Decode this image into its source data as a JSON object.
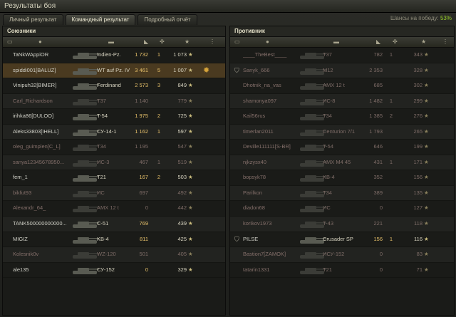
{
  "window": {
    "title": "Результаты боя"
  },
  "tabs": [
    {
      "label": "Личный результат",
      "active": false
    },
    {
      "label": "Командный результат",
      "active": true
    },
    {
      "label": "Подробный отчёт",
      "active": false
    }
  ],
  "chance": {
    "label": "Шансы на победу:",
    "value": "53%"
  },
  "allies": {
    "title": "Союзники",
    "rows": [
      {
        "player": "TaNkWAppiOR",
        "vehicle": "Indien-Pz.",
        "dmg": "1 732",
        "frags": "1",
        "xp": "1 073",
        "dead": false
      },
      {
        "player": "spiddi001[BALUZ]",
        "vehicle": "WT auf Pz. IV",
        "dmg": "3 461",
        "frags": "5",
        "xp": "1 007",
        "dead": false,
        "highlight": true,
        "medal": true
      },
      {
        "player": "Vinipuh32[BIMER]",
        "vehicle": "Ferdinand",
        "dmg": "2 573",
        "frags": "3",
        "xp": "849",
        "dead": false
      },
      {
        "player": "Carl_Richardson",
        "vehicle": "T37",
        "dmg": "1 140",
        "frags": "",
        "xp": "779",
        "dead": true
      },
      {
        "player": "irihka86[DULOO]",
        "vehicle": "T-54",
        "dmg": "1 975",
        "frags": "2",
        "xp": "725",
        "dead": false
      },
      {
        "player": "Aleks33803[IHELL]",
        "vehicle": "СУ-14-1",
        "dmg": "1 162",
        "frags": "1",
        "xp": "597",
        "dead": false
      },
      {
        "player": "oleg_guimplen[C_L]",
        "vehicle": "T34",
        "dmg": "1 195",
        "frags": "",
        "xp": "547",
        "dead": true
      },
      {
        "player": "sanya12345678950...",
        "vehicle": "ИС-3",
        "dmg": "467",
        "frags": "1",
        "xp": "519",
        "dead": true
      },
      {
        "player": "fem_1",
        "vehicle": "T21",
        "dmg": "167",
        "frags": "2",
        "xp": "503",
        "dead": false
      },
      {
        "player": "bikfut93",
        "vehicle": "ИС",
        "dmg": "697",
        "frags": "",
        "xp": "492",
        "dead": true
      },
      {
        "player": "Alexandr_64_",
        "vehicle": "AMX 12 t",
        "dmg": "0",
        "frags": "",
        "xp": "442",
        "dead": true
      },
      {
        "player": "TANK500000000000...",
        "vehicle": "C-51",
        "dmg": "769",
        "frags": "",
        "xp": "439",
        "dead": false
      },
      {
        "player": "MIGIZ",
        "vehicle": "KB-4",
        "dmg": "811",
        "frags": "",
        "xp": "425",
        "dead": false
      },
      {
        "player": "Kolesnik0v",
        "vehicle": "WZ-120",
        "dmg": "501",
        "frags": "",
        "xp": "405",
        "dead": true
      },
      {
        "player": "ale135",
        "vehicle": "СУ-152",
        "dmg": "0",
        "frags": "",
        "xp": "329",
        "dead": false
      }
    ]
  },
  "enemies": {
    "title": "Противник",
    "rows": [
      {
        "player": "____TheBest____",
        "vehicle": "T37",
        "dmg": "782",
        "frags": "1",
        "xp": "343",
        "dead": true
      },
      {
        "player": "Sanyk_666",
        "vehicle": "M12",
        "dmg": "2 353",
        "frags": "",
        "xp": "328",
        "dead": true,
        "badge": true
      },
      {
        "player": "Dhotnik_na_vas",
        "vehicle": "AMX 12 t",
        "dmg": "685",
        "frags": "",
        "xp": "302",
        "dead": true
      },
      {
        "player": "shamonya097",
        "vehicle": "ИС-8",
        "dmg": "1 482",
        "frags": "1",
        "xp": "299",
        "dead": true
      },
      {
        "player": "Kail56rus",
        "vehicle": "T34",
        "dmg": "1 385",
        "frags": "2",
        "xp": "276",
        "dead": true
      },
      {
        "player": "timerlan2011",
        "vehicle": "Centurion 7/1",
        "dmg": "1 793",
        "frags": "",
        "xp": "265",
        "dead": true
      },
      {
        "player": "Deville111111[S-BR]",
        "vehicle": "T-54",
        "dmg": "646",
        "frags": "",
        "xp": "199",
        "dead": true
      },
      {
        "player": "njkzysx40",
        "vehicle": "AMX M4 45",
        "dmg": "431",
        "frags": "1",
        "xp": "171",
        "dead": true
      },
      {
        "player": "bopsyk78",
        "vehicle": "KB-4",
        "dmg": "352",
        "frags": "",
        "xp": "156",
        "dead": true
      },
      {
        "player": "Parilkon",
        "vehicle": "T34",
        "dmg": "389",
        "frags": "",
        "xp": "135",
        "dead": true
      },
      {
        "player": "diadon68",
        "vehicle": "ИС",
        "dmg": "0",
        "frags": "",
        "xp": "127",
        "dead": true
      },
      {
        "player": "korikov1973",
        "vehicle": "T-43",
        "dmg": "221",
        "frags": "",
        "xp": "118",
        "dead": true
      },
      {
        "player": "PILSE",
        "vehicle": "Crusader SP",
        "dmg": "156",
        "frags": "1",
        "xp": "116",
        "dead": false,
        "badge": true
      },
      {
        "player": "Bastion7[ZAMOK]",
        "vehicle": "ИСУ-152",
        "dmg": "0",
        "frags": "",
        "xp": "83",
        "dead": true
      },
      {
        "player": "tatarin1331",
        "vehicle": "T21",
        "dmg": "0",
        "frags": "",
        "xp": "71",
        "dead": true
      }
    ]
  },
  "icons": {
    "chat": "chat-icon",
    "player": "player-icon",
    "vehicle": "vehicle-icon",
    "damage": "damage-icon",
    "frags": "frags-icon",
    "xp": "star-icon",
    "medal": "medal-icon"
  },
  "colors": {
    "win_chance": "#9ad12a",
    "highlight_row": "#4a3a20",
    "damage": "#e6c06a",
    "dead": "#846f6a"
  }
}
